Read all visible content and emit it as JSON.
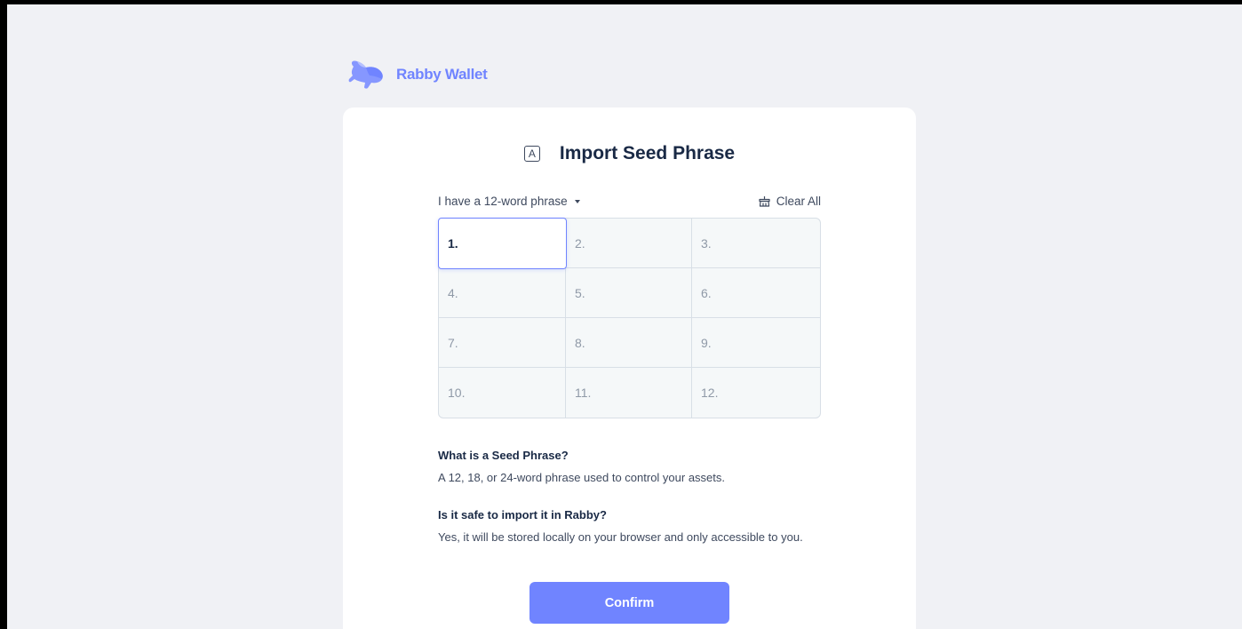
{
  "brand": {
    "name": "Rabby Wallet",
    "logo_icon": "rabbit-logo-icon",
    "color": "#7084ff"
  },
  "header": {
    "title": "Import Seed Phrase",
    "title_icon": "A",
    "title_icon_name": "letter-a-icon"
  },
  "toolbar": {
    "word_count_selector": "I have a 12-word phrase",
    "clear_all_label": "Clear All",
    "clear_all_icon": "broom-icon"
  },
  "seed_inputs": [
    {
      "placeholder": "1."
    },
    {
      "placeholder": "2."
    },
    {
      "placeholder": "3."
    },
    {
      "placeholder": "4."
    },
    {
      "placeholder": "5."
    },
    {
      "placeholder": "6."
    },
    {
      "placeholder": "7."
    },
    {
      "placeholder": "8."
    },
    {
      "placeholder": "9."
    },
    {
      "placeholder": "10."
    },
    {
      "placeholder": "11."
    },
    {
      "placeholder": "12."
    }
  ],
  "active_input_index": 0,
  "faq": [
    {
      "question": "What is a Seed Phrase?",
      "answer": "A 12, 18, or 24-word phrase used to control your assets."
    },
    {
      "question": "Is it safe to import it in Rabby?",
      "answer": "Yes, it will be stored locally on your browser and only accessible to you."
    }
  ],
  "actions": {
    "confirm_label": "Confirm"
  },
  "colors": {
    "accent": "#7084ff",
    "background": "#f0f1f5",
    "card": "#ffffff",
    "text_primary": "#192945",
    "text_secondary": "#3e495e",
    "placeholder": "#8f99a7"
  }
}
